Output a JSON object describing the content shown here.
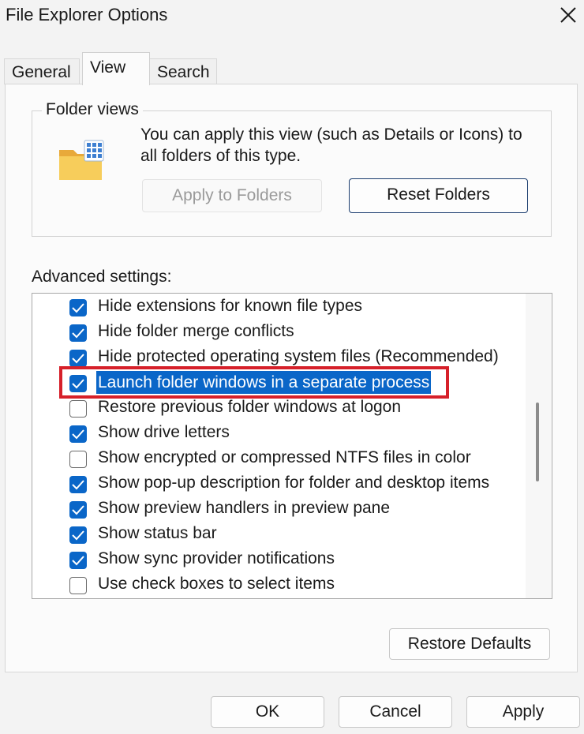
{
  "window": {
    "title": "File Explorer Options"
  },
  "tabs": [
    {
      "label": "General"
    },
    {
      "label": "View",
      "active": true
    },
    {
      "label": "Search"
    }
  ],
  "folder_views": {
    "group_label": "Folder views",
    "description": "You can apply this view (such as Details or Icons) to all folders of this type.",
    "apply_label": "Apply to Folders",
    "reset_label": "Reset Folders"
  },
  "advanced": {
    "label": "Advanced settings:",
    "items": [
      {
        "label": "Hide extensions for known file types",
        "checked": true
      },
      {
        "label": "Hide folder merge conflicts",
        "checked": true
      },
      {
        "label": "Hide protected operating system files (Recommended)",
        "checked": true
      },
      {
        "label": "Launch folder windows in a separate process",
        "checked": true,
        "selected": true
      },
      {
        "label": "Restore previous folder windows at logon",
        "checked": false
      },
      {
        "label": "Show drive letters",
        "checked": true
      },
      {
        "label": "Show encrypted or compressed NTFS files in color",
        "checked": false
      },
      {
        "label": "Show pop-up description for folder and desktop items",
        "checked": true
      },
      {
        "label": "Show preview handlers in preview pane",
        "checked": true
      },
      {
        "label": "Show status bar",
        "checked": true
      },
      {
        "label": "Show sync provider notifications",
        "checked": true
      },
      {
        "label": "Use check boxes to select items",
        "checked": false
      }
    ],
    "restore_label": "Restore Defaults"
  },
  "footer": {
    "ok_label": "OK",
    "cancel_label": "Cancel",
    "apply_label": "Apply"
  },
  "colors": {
    "accent": "#0a66c8",
    "highlight_box": "#d6202a"
  }
}
